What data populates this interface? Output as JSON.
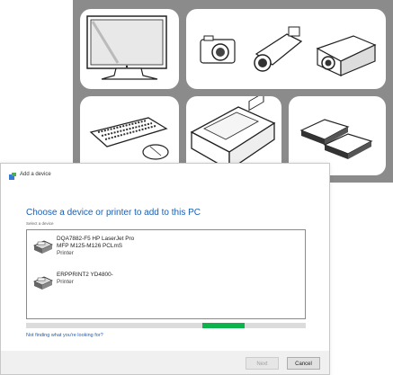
{
  "window": {
    "title": "Add a device"
  },
  "dialog": {
    "heading": "Choose a device or printer to add to this PC",
    "subheading": "Select a device",
    "devices": [
      {
        "name_line1": "DQA7882-F5  HP LaserJet Pro",
        "name_line2": "MFP M125-M126 PCLmS",
        "type": "Printer",
        "icon": "printer-icon"
      },
      {
        "name_line1": "ERPPRINT2  YD4800-",
        "name_line2": "",
        "type": "Printer",
        "icon": "printer-icon"
      }
    ],
    "progress": {
      "segment_start": 0.63,
      "segment_end": 0.78,
      "color": "#0bb34a"
    },
    "help_link": "Not finding what you're looking for?",
    "buttons": {
      "next": "Next",
      "cancel": "Cancel"
    }
  },
  "banner": {
    "background": "#8b8b8b",
    "illustrations": [
      "monitor-icon",
      "camera-icon",
      "camcorder-icon",
      "projector-icon",
      "keyboard-icon",
      "mouse-icon",
      "printer-icon",
      "external-drive-icon"
    ]
  },
  "colors": {
    "accent": "#1a5fb4",
    "progress": "#0bb34a"
  }
}
